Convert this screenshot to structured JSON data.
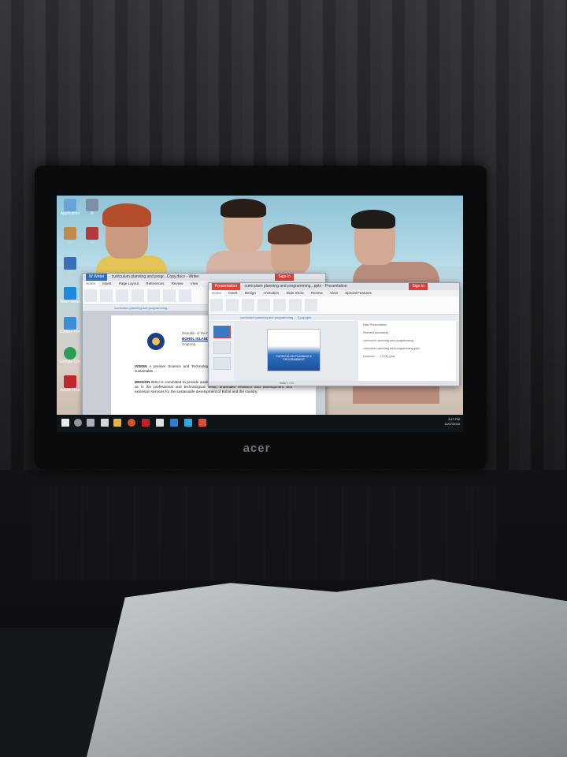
{
  "brand": "acer",
  "desktop_icons": [
    {
      "label": "Application",
      "icon": "app-icon",
      "color": "#6aa3d8"
    },
    {
      "label": "R",
      "icon": "r-icon",
      "color": "#7e8fa8"
    },
    {
      "label": "...",
      "icon": "doc-icon",
      "color": "#c08a4a"
    },
    {
      "label": "...",
      "icon": "doc-icon",
      "color": "#b53b3b"
    },
    {
      "label": "...",
      "icon": "folder-icon",
      "color": "#3b6fb5"
    },
    {
      "label": "Team viewer",
      "icon": "teamviewer-icon",
      "color": "#1d8ae0"
    },
    {
      "label": "Control Panel",
      "icon": "control-panel-icon",
      "color": "#3c8ed6"
    },
    {
      "label": "Google Chrome",
      "icon": "chrome-icon",
      "color": "#2e9d53"
    },
    {
      "label": "Adobe Reader",
      "icon": "pdf-icon",
      "color": "#c4262e"
    }
  ],
  "writer": {
    "app": "W Writer",
    "title": "curriculum planning and progr...Copy.docx - Writer",
    "signin": "Sign In",
    "menus": [
      "Home",
      "Insert",
      "Page Layout",
      "References",
      "Review",
      "View"
    ],
    "doctab": "curriculum planning and programming...",
    "header_lines": [
      "Republic of the Philippines",
      "BOHOL ISLAND ...",
      "Cogtong ..."
    ],
    "vision_label": "VISION",
    "vision_text": "A premier Science and Technology university ... and virtuous human resource for sustainable ...",
    "mission_label": "MISSION",
    "mission_text": "BISU is committed to provide quality higher education in the arts and sciences, as well as in the professional and technological fields; undertake research and development and extension services for the sustainable development of Bohol and the country."
  },
  "presentation": {
    "app": "Presentation",
    "title": "curriculum planning and programming...pptx - Presentation",
    "signin": "Sign In",
    "menus": [
      "Home",
      "Insert",
      "Design",
      "Animation",
      "Slide Show",
      "Review",
      "View",
      "Special Features"
    ],
    "doctab": "curriculum planning and programming ... Copy.pptx",
    "slide_text": "CURRICULUM PLANNING & PROGRAMMING",
    "taskpane": [
      "New Presentation",
      "Recent Documents",
      "curriculum planning and programming...",
      "curriculum planning and programming.pptx",
      "Lectures - ... (TOS).pptx"
    ],
    "status": "Slide 1 / 10"
  },
  "taskbar": {
    "time": "3:47 PM",
    "date": "11/07/2018"
  }
}
